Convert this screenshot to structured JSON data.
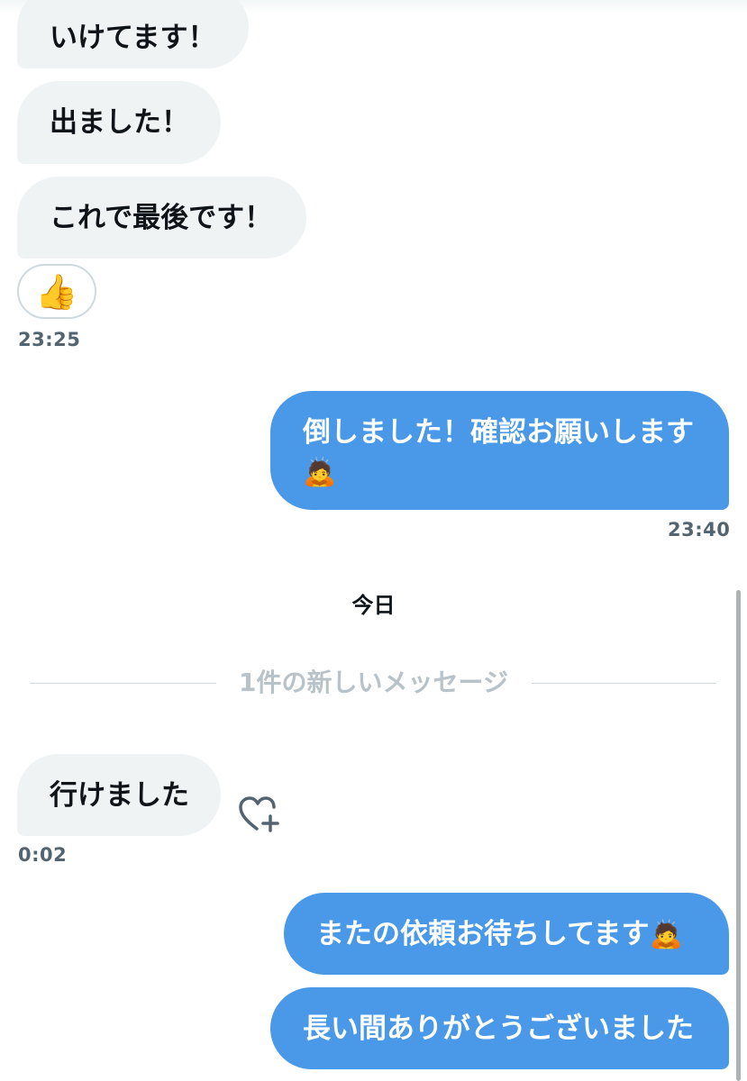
{
  "messages": [
    {
      "text": "いけてます！"
    },
    {
      "text": "出ました！"
    },
    {
      "text": "これで最後です！"
    },
    {
      "text": "倒しました！確認お願いします"
    },
    {
      "text": "行けました"
    },
    {
      "text": "またの依頼お待ちしてます"
    },
    {
      "text": "長い間ありがとうございました"
    }
  ],
  "reaction": {
    "emoji": "👍",
    "name": "thumbs-up"
  },
  "bow_emoji": "🙇",
  "timestamps": {
    "first": "23:25",
    "second": "23:40",
    "third": "0:02"
  },
  "day_separator": "今日",
  "new_messages_divider": "1件の新しいメッセージ",
  "icons": {
    "add_reaction": "heart-plus-icon"
  },
  "colors": {
    "outgoing_bubble": "#4a98e8",
    "incoming_bubble": "#eff3f4",
    "timestamp": "#536471",
    "divider_text": "#b8c2c9"
  }
}
